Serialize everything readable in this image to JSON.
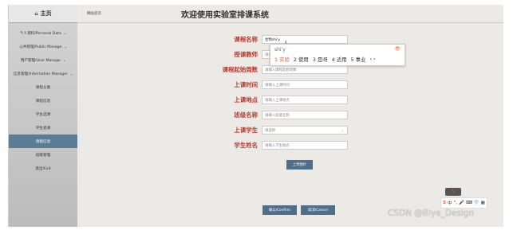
{
  "sidebar": {
    "home_label": "主页",
    "items": [
      {
        "label": "个人资料/Personal Data",
        "chevron": "⌄"
      },
      {
        "label": "公共管理/Public Manage",
        "chevron": "⌄"
      },
      {
        "label": "用户管理/User Manage",
        "chevron": "⌄"
      },
      {
        "label": "信息管理/Information Manager",
        "chevron": "⌄"
      },
      {
        "label": "课程分类",
        "chevron": ""
      },
      {
        "label": "课程信息",
        "chevron": ""
      },
      {
        "label": "学生选课",
        "chevron": ""
      },
      {
        "label": "学生退课",
        "chevron": ""
      },
      {
        "label": "请假信息",
        "chevron": ""
      },
      {
        "label": "班级管理",
        "chevron": ""
      },
      {
        "label": "退出/Exit",
        "chevron": ""
      }
    ],
    "active_index": 8
  },
  "header": {
    "breadcrumb": "网站首页",
    "title": "欢迎使用实验室排课系统"
  },
  "form": {
    "fields": [
      {
        "label": "课程名称",
        "value": "生物shi'y",
        "placeholder": ""
      },
      {
        "label": "授课教师",
        "value": "",
        "placeholder": "请选择"
      },
      {
        "label": "课程起始周数",
        "value": "",
        "placeholder": "请输入课程起始周数"
      },
      {
        "label": "上课时间",
        "value": "",
        "placeholder": "请输入上课时间"
      },
      {
        "label": "上课地点",
        "value": "",
        "placeholder": "请输入上课地点"
      },
      {
        "label": "班级名称",
        "value": "",
        "placeholder": "请输入班级名称"
      },
      {
        "label": "上课学生",
        "value": "",
        "placeholder": "请选择"
      },
      {
        "label": "学生姓名",
        "value": "",
        "placeholder": "请输入学生姓名"
      }
    ],
    "upload_label": "上传图片",
    "confirm_label": "确认/Confirm",
    "cancel_label": "取消/Cancel"
  },
  "ime": {
    "pinyin": "shi'y",
    "candidates": [
      "1 实验",
      "2 使用",
      "3 是呀",
      "4 适用",
      "5 事业"
    ],
    "more": "‹ ›"
  },
  "tray": {
    "items": [
      "S",
      "中",
      "°,",
      "🎤",
      "⌨",
      "👕",
      "▦"
    ]
  },
  "watermark": "CSDN @Biye_Design"
}
